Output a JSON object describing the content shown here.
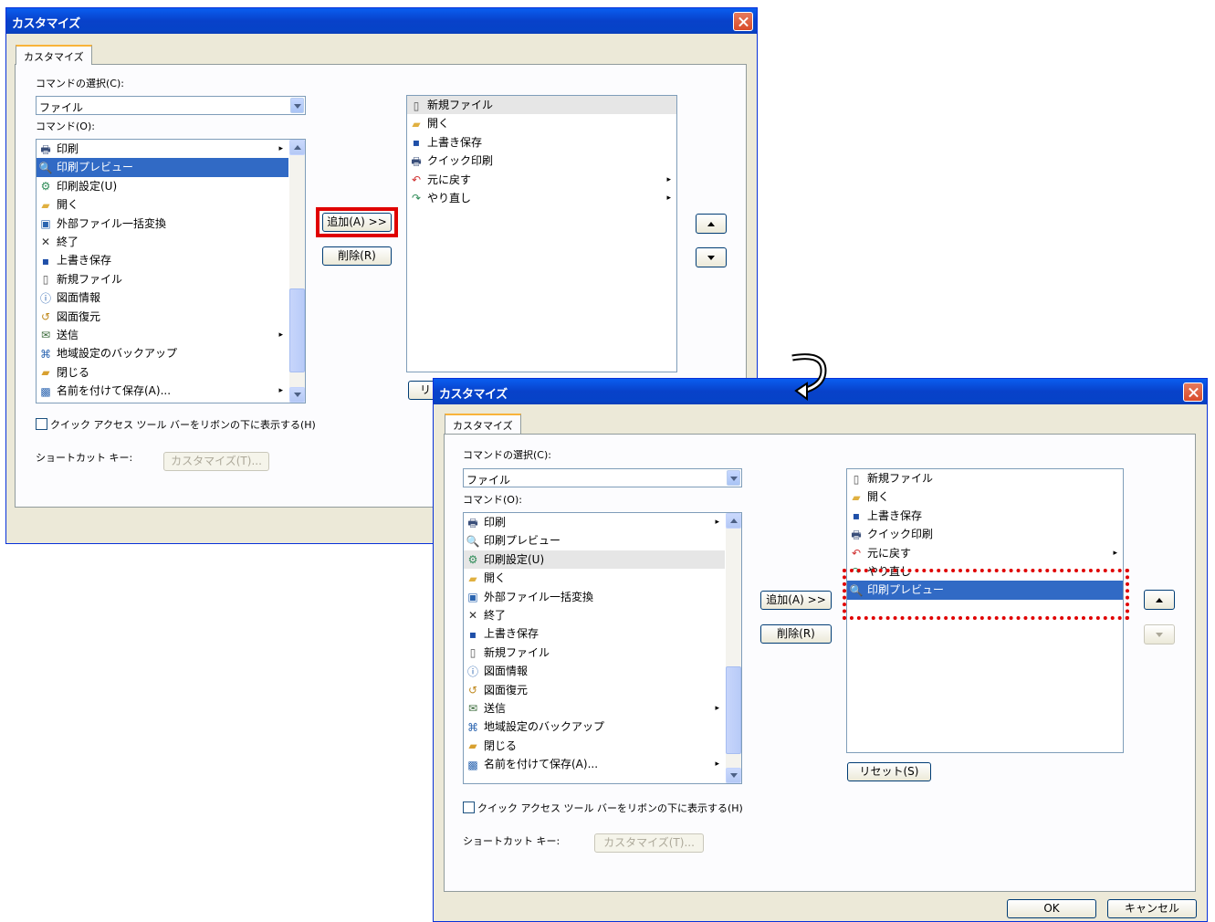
{
  "dialog": {
    "title": "カスタマイズ",
    "tab_label": "カスタマイズ",
    "command_category_label": "コマンドの選択(C):",
    "command_category_value": "ファイル",
    "commands_label": "コマンド(O):",
    "add_button": "追加(A) >>",
    "remove_button": "削除(R)",
    "reset_button": "リセット(S)",
    "ribbon_checkbox_label": "クイック アクセス ツール バーをリボンの下に表示する(H)",
    "shortcut_label": "ショートカット キー:",
    "shortcut_customize_button": "カスタマイズ(T)...",
    "ok_button": "OK",
    "cancel_button": "キャンセル"
  },
  "reset_partial": "リ",
  "commands": [
    {
      "label": "印刷",
      "icon": "printer-icon",
      "glyph": "🖶",
      "color": "#3a4f7a",
      "submenu": true
    },
    {
      "label": "印刷プレビュー",
      "icon": "print-preview-icon",
      "glyph": "🔍",
      "color": "#2c5aa0",
      "submenu": false
    },
    {
      "label": "印刷設定(U)",
      "icon": "print-settings-icon",
      "glyph": "⚙",
      "color": "#2e8b57",
      "submenu": false
    },
    {
      "label": "開く",
      "icon": "open-folder-icon",
      "glyph": "▰",
      "color": "#e0b040",
      "submenu": false
    },
    {
      "label": "外部ファイル一括変換",
      "icon": "batch-convert-icon",
      "glyph": "▣",
      "color": "#2a64b0",
      "submenu": false
    },
    {
      "label": "終了",
      "icon": "exit-icon",
      "glyph": "✕",
      "color": "#333333",
      "submenu": false
    },
    {
      "label": "上書き保存",
      "icon": "save-icon",
      "glyph": "▪",
      "color": "#1f4fa8",
      "submenu": false
    },
    {
      "label": "新規ファイル",
      "icon": "new-file-icon",
      "glyph": "▯",
      "color": "#555555",
      "submenu": false
    },
    {
      "label": "図面情報",
      "icon": "drawing-info-icon",
      "glyph": "ⓘ",
      "color": "#2a64b0",
      "submenu": false
    },
    {
      "label": "図面復元",
      "icon": "drawing-restore-icon",
      "glyph": "↺",
      "color": "#c08a20",
      "submenu": false
    },
    {
      "label": "送信",
      "icon": "send-icon",
      "glyph": "✉",
      "color": "#3a6a3a",
      "submenu": true
    },
    {
      "label": "地域設定のバックアップ",
      "icon": "region-backup-icon",
      "glyph": "⌘",
      "color": "#2a64b0",
      "submenu": false
    },
    {
      "label": "閉じる",
      "icon": "close-folder-icon",
      "glyph": "▰",
      "color": "#d8a030",
      "submenu": false
    },
    {
      "label": "名前を付けて保存(A)...",
      "icon": "save-as-icon",
      "glyph": "▩",
      "color": "#2a64b0",
      "submenu": true
    }
  ],
  "toolbar_before": [
    {
      "label": "新規ファイル",
      "icon": "new-file-icon",
      "glyph": "▯",
      "color": "#555555",
      "submenu": false
    },
    {
      "label": "開く",
      "icon": "open-folder-icon",
      "glyph": "▰",
      "color": "#e0b040",
      "submenu": false
    },
    {
      "label": "上書き保存",
      "icon": "save-icon",
      "glyph": "▪",
      "color": "#1f4fa8",
      "submenu": false
    },
    {
      "label": "クイック印刷",
      "icon": "quick-print-icon",
      "glyph": "🖶",
      "color": "#3a4f7a",
      "submenu": false
    },
    {
      "label": "元に戻す",
      "icon": "undo-icon",
      "glyph": "↶",
      "color": "#d03030",
      "submenu": true
    },
    {
      "label": "やり直し",
      "icon": "redo-icon",
      "glyph": "↷",
      "color": "#2e8b57",
      "submenu": true
    }
  ],
  "toolbar_after": [
    {
      "label": "新規ファイル",
      "icon": "new-file-icon",
      "glyph": "▯",
      "color": "#555555",
      "submenu": false
    },
    {
      "label": "開く",
      "icon": "open-folder-icon",
      "glyph": "▰",
      "color": "#e0b040",
      "submenu": false
    },
    {
      "label": "上書き保存",
      "icon": "save-icon",
      "glyph": "▪",
      "color": "#1f4fa8",
      "submenu": false
    },
    {
      "label": "クイック印刷",
      "icon": "quick-print-icon",
      "glyph": "🖶",
      "color": "#3a4f7a",
      "submenu": false
    },
    {
      "label": "元に戻す",
      "icon": "undo-icon",
      "glyph": "↶",
      "color": "#d03030",
      "submenu": true
    },
    {
      "label": "やり直し",
      "icon": "redo-icon",
      "glyph": "↷",
      "color": "#2e8b57",
      "submenu": false
    },
    {
      "label": "印刷プレビュー",
      "icon": "print-preview-icon",
      "glyph": "🔍",
      "color": "#2c5aa0",
      "submenu": false
    }
  ],
  "colors": {
    "title_bar": "#0841c9",
    "selection": "#316ac5",
    "highlight_red": "#e00000",
    "dialog_bg": "#ece9d8"
  }
}
